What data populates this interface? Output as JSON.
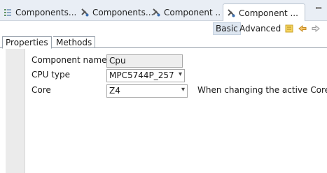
{
  "tabs": [
    {
      "label": "Components...",
      "icon": "component-list-icon",
      "active": false
    },
    {
      "label": "Components...",
      "icon": "component-inspector-icon",
      "active": false
    },
    {
      "label": "Component ...",
      "icon": "component-inspector-icon",
      "active": false
    },
    {
      "label": "Component ...",
      "icon": "component-inspector-icon",
      "active": true
    }
  ],
  "toolbar": {
    "basic_label": "Basic",
    "advanced_label": "Advanced",
    "icons": [
      "note-icon",
      "back-arrow-icon",
      "forward-arrow-icon"
    ]
  },
  "inner_tabs": [
    {
      "label": "Properties",
      "active": true
    },
    {
      "label": "Methods",
      "active": false
    }
  ],
  "properties": [
    {
      "label": "Component name",
      "value": "Cpu",
      "type": "readonly"
    },
    {
      "label": "CPU type",
      "value": "MPC5744P_257",
      "type": "select"
    },
    {
      "label": "Core",
      "value": "Z4",
      "type": "select",
      "hint": "When changing the active Core ..."
    }
  ],
  "colors": {
    "tab_bg": "#e9eef5",
    "basic_highlight": "#dde6f0",
    "gutter": "#ebebeb"
  }
}
